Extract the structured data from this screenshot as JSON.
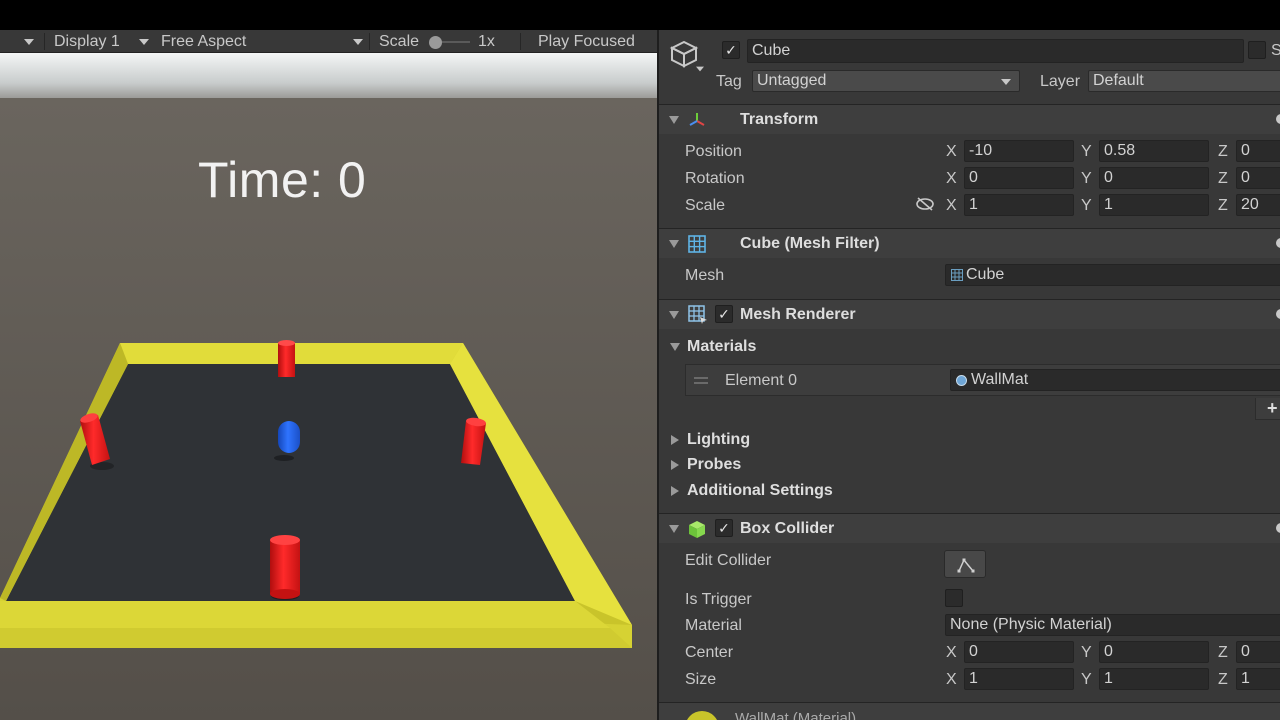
{
  "game_toolbar": {
    "display": "Display 1",
    "aspect": "Free Aspect",
    "scale_label": "Scale",
    "scale_value": "1x",
    "play_mode": "Play Focused"
  },
  "scene": {
    "timer_text": "Time: 0"
  },
  "inspector": {
    "object_name": "Cube",
    "static_label": "S",
    "tag_label": "Tag",
    "tag_value": "Untagged",
    "layer_label": "Layer",
    "layer_value": "Default",
    "transform": {
      "title": "Transform",
      "position_label": "Position",
      "rotation_label": "Rotation",
      "scale_label": "Scale",
      "position": {
        "x": "-10",
        "y": "0.58",
        "z": "0"
      },
      "rotation": {
        "x": "0",
        "y": "0",
        "z": "0"
      },
      "scale": {
        "x": "1",
        "y": "1",
        "z": "20"
      }
    },
    "mesh_filter": {
      "title": "Cube (Mesh Filter)",
      "mesh_label": "Mesh",
      "mesh_value": "Cube"
    },
    "mesh_renderer": {
      "title": "Mesh Renderer",
      "materials_label": "Materials",
      "element_label": "Element 0",
      "element_value": "WallMat",
      "add_symbol": "+",
      "lighting_label": "Lighting",
      "probes_label": "Probes",
      "additional_label": "Additional Settings"
    },
    "box_collider": {
      "title": "Box Collider",
      "edit_collider_label": "Edit Collider",
      "is_trigger_label": "Is Trigger",
      "material_label": "Material",
      "material_value": "None (Physic Material)",
      "center_label": "Center",
      "size_label": "Size",
      "center": {
        "x": "0",
        "y": "0",
        "z": "0"
      },
      "size": {
        "x": "1",
        "y": "1",
        "z": "1"
      }
    },
    "material_footer": "WallMat (Material)",
    "axis": {
      "x": "X",
      "y": "Y",
      "z": "Z"
    }
  },
  "colors": {
    "wall_yellow": "#d6d233",
    "floor": "#2f3236",
    "pillar_red": "#e52020",
    "ball_blue": "#1f5fe0",
    "ground": "#5a5650"
  }
}
